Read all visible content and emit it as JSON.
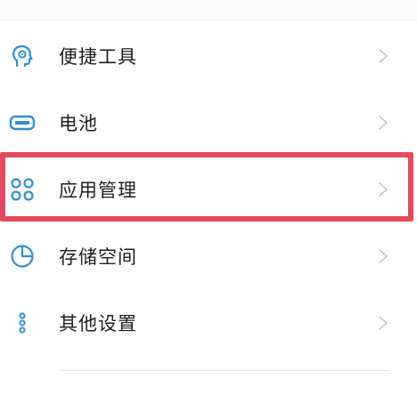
{
  "items": [
    {
      "label": "便捷工具",
      "icon": "head-tool-icon"
    },
    {
      "label": "电池",
      "icon": "battery-icon"
    },
    {
      "label": "应用管理",
      "icon": "app-grid-icon"
    },
    {
      "label": "存储空间",
      "icon": "pie-chart-icon"
    },
    {
      "label": "其他设置",
      "icon": "more-dots-icon"
    }
  ],
  "colors": {
    "icon_blue": "#2f8fd8",
    "highlight_red": "#e64a5e",
    "chevron_gray": "#c4c4c4",
    "text": "#1f1f1f"
  }
}
